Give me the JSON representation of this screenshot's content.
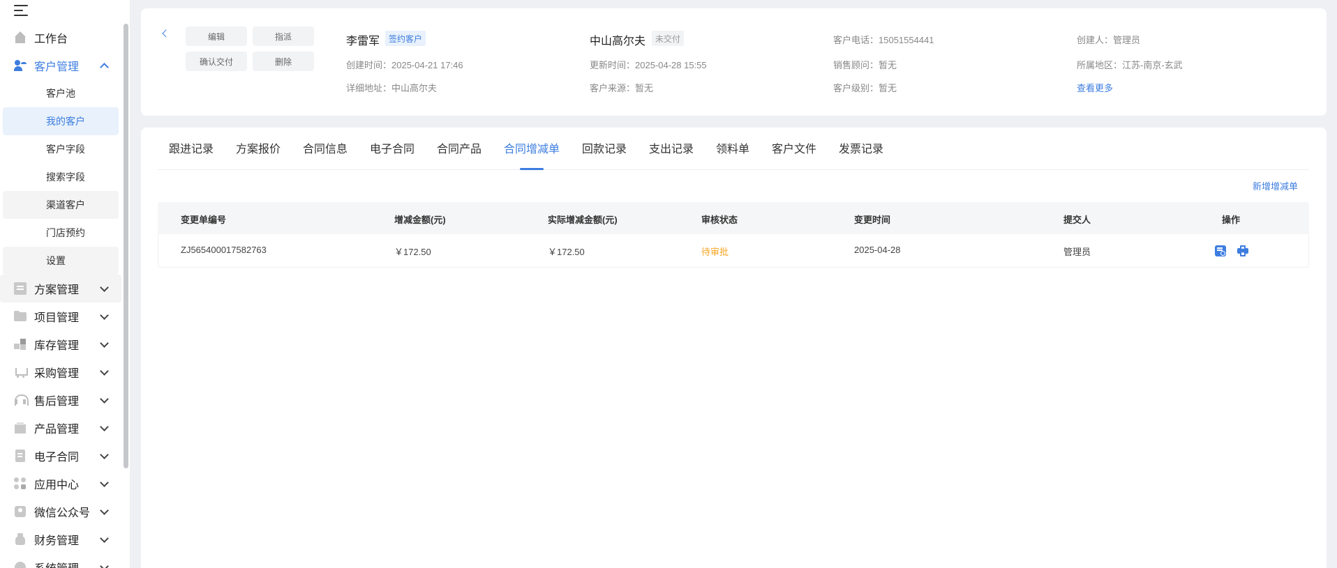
{
  "sidebar": {
    "items": [
      {
        "label": "工作台",
        "icon": "home-icon"
      },
      {
        "label": "客户管理",
        "icon": "customer-icon"
      },
      {
        "label": "方案管理",
        "icon": "plan-icon"
      },
      {
        "label": "项目管理",
        "icon": "folder-icon"
      },
      {
        "label": "库存管理",
        "icon": "inventory-icon"
      },
      {
        "label": "采购管理",
        "icon": "cart-icon"
      },
      {
        "label": "售后管理",
        "icon": "headset-icon"
      },
      {
        "label": "产品管理",
        "icon": "product-icon"
      },
      {
        "label": "电子合同",
        "icon": "contract-icon"
      },
      {
        "label": "应用中心",
        "icon": "apps-icon"
      },
      {
        "label": "微信公众号",
        "icon": "wechat-icon"
      },
      {
        "label": "财务管理",
        "icon": "money-icon"
      },
      {
        "label": "系统管理",
        "icon": "system-icon"
      }
    ],
    "sub_items": [
      {
        "label": "客户池"
      },
      {
        "label": "我的客户"
      },
      {
        "label": "客户字段"
      },
      {
        "label": "搜索字段"
      },
      {
        "label": "渠道客户"
      },
      {
        "label": "门店预约"
      },
      {
        "label": "设置"
      }
    ]
  },
  "header": {
    "buttons": {
      "edit": "编辑",
      "assign": "指派",
      "confirm_delivery": "确认交付",
      "delete": "删除"
    },
    "customer_name": "李雷军",
    "customer_tag": "签约客户",
    "project_name": "中山高尔夫",
    "delivery_tag": "未交付",
    "created_time": "创建时间：2025-04-21 17:46",
    "address": "详细地址：中山高尔夫",
    "updated_time": "更新时间：2025-04-28 15:55",
    "source": "客户来源：暂无",
    "phone": "客户电话：15051554441",
    "sales": "销售顾问：暂无",
    "level": "客户级别：暂无",
    "creator": "创建人：管理员",
    "region": "所属地区：江苏-南京-玄武",
    "more": "查看更多"
  },
  "tabs": [
    {
      "label": "跟进记录"
    },
    {
      "label": "方案报价"
    },
    {
      "label": "合同信息"
    },
    {
      "label": "电子合同"
    },
    {
      "label": "合同产品"
    },
    {
      "label": "合同增减单",
      "active": true
    },
    {
      "label": "回款记录"
    },
    {
      "label": "支出记录"
    },
    {
      "label": "领料单"
    },
    {
      "label": "客户文件"
    },
    {
      "label": "发票记录"
    }
  ],
  "new_button": "新增增减单",
  "table": {
    "columns": [
      "变更单编号",
      "增减金额(元)",
      "实际增减金额(元)",
      "审核状态",
      "变更时间",
      "提交人",
      "操作"
    ],
    "rows": [
      {
        "id": "ZJ565400017582763",
        "amount": "￥172.50",
        "actual": "￥172.50",
        "status": "待审批",
        "time": "2025-04-28",
        "submitter": "管理员"
      }
    ]
  },
  "colors": {
    "accent": "#3d7de0",
    "pending": "#f5a623"
  }
}
